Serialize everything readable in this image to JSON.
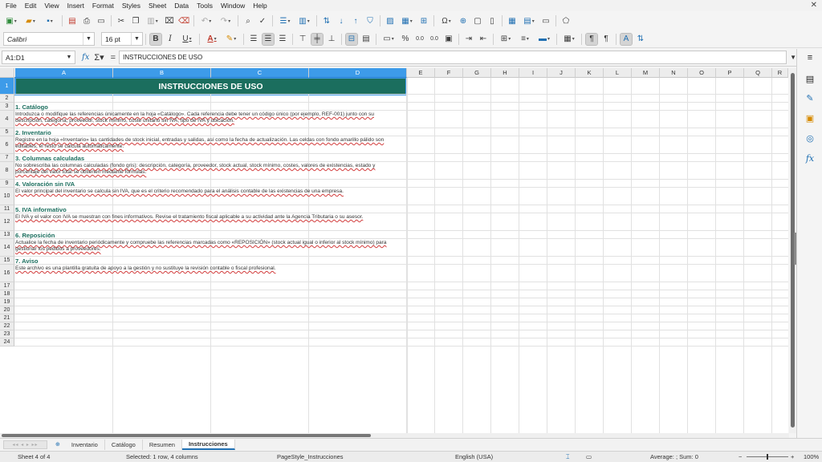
{
  "menu": [
    "File",
    "Edit",
    "View",
    "Insert",
    "Format",
    "Styles",
    "Sheet",
    "Data",
    "Tools",
    "Window",
    "Help"
  ],
  "window": {
    "close_glyph": "✕"
  },
  "toolbar2": {
    "font_name": "Calibri",
    "font_size": "16 pt",
    "bold": "B",
    "italic": "I",
    "underline": "U",
    "font_color_letter": "A",
    "percent": "%",
    "decimal_a": "0.0",
    "decimal_b": "0.0"
  },
  "formula_bar": {
    "name_box": "A1:D1",
    "content": "INSTRUCCIONES DE USO"
  },
  "columns": [
    "A",
    "B",
    "C",
    "D",
    "E",
    "F",
    "G",
    "H",
    "I",
    "J",
    "K",
    "L",
    "M",
    "N",
    "O",
    "P",
    "Q",
    "R"
  ],
  "rows": [
    "1",
    "2",
    "3",
    "4",
    "5",
    "6",
    "7",
    "8",
    "9",
    "10",
    "11",
    "12",
    "13",
    "14",
    "15",
    "16",
    "17",
    "18",
    "19",
    "20",
    "21",
    "22",
    "23",
    "24"
  ],
  "sheet": {
    "title": "INSTRUCCIONES DE USO",
    "sections": [
      {
        "heading": "1. Catálogo",
        "body": "Introduzca o modifique las referencias únicamente en la hoja «Catálogo». Cada referencia debe tener un código único (por ejemplo, REF-001) junto con su descripción, categoría, proveedor, stock mínimo, coste unitario sin IVA, tipo de IVA y ubicación."
      },
      {
        "heading": "2. Inventario",
        "body": "Registre en la hoja «Inventario» las cantidades de stock inicial, entradas y salidas, así como la fecha de actualización. Las celdas con fondo amarillo pálido son editables; el resto se calcula automáticamente."
      },
      {
        "heading": "3. Columnas calculadas",
        "body": "No sobrescriba las columnas calculadas (fondo gris): descripción, categoría, proveedor, stock actual, stock mínimo, costes, valores de existencias, estado y porcentaje del valor total se obtienen mediante fórmulas."
      },
      {
        "heading": "4. Valoración sin IVA",
        "body": "El valor principal del inventario se calcula sin IVA, que es el criterio recomendado para el análisis contable de las existencias de una empresa."
      },
      {
        "heading": "5. IVA informativo",
        "body": "El IVA y el valor con IVA se muestran con fines informativos. Revise el tratamiento fiscal aplicable a su actividad ante la Agencia Tributaria o su asesor."
      },
      {
        "heading": "6. Reposición",
        "body": "Actualice la fecha de inventario periódicamente y compruebe las referencias marcadas como «REPOSICIÓN» (stock actual igual o inferior al stock mínimo) para gestionar los pedidos a proveedores."
      },
      {
        "heading": "7. Aviso",
        "body": "Este archivo es una plantilla gratuita de apoyo a la gestión y no sustituye la revisión contable o fiscal profesional."
      }
    ]
  },
  "tabs": {
    "add_glyph": "⊕",
    "items": [
      "Inventario",
      "Catálogo",
      "Resumen",
      "Instrucciones"
    ],
    "active": "Instrucciones"
  },
  "status": {
    "sheet": "Sheet 4 of 4",
    "selection": "Selected: 1 row, 4 columns",
    "page_style": "PageStyle_Instrucciones",
    "language": "English (USA)",
    "stats": "Average: ; Sum: 0",
    "zoom": "100%",
    "zoom_minus": "−",
    "zoom_plus": "+"
  },
  "colors": {
    "title_fill": "#1b6e5e",
    "heading_text": "#1b6e5e",
    "selection": "#3d9be9"
  }
}
